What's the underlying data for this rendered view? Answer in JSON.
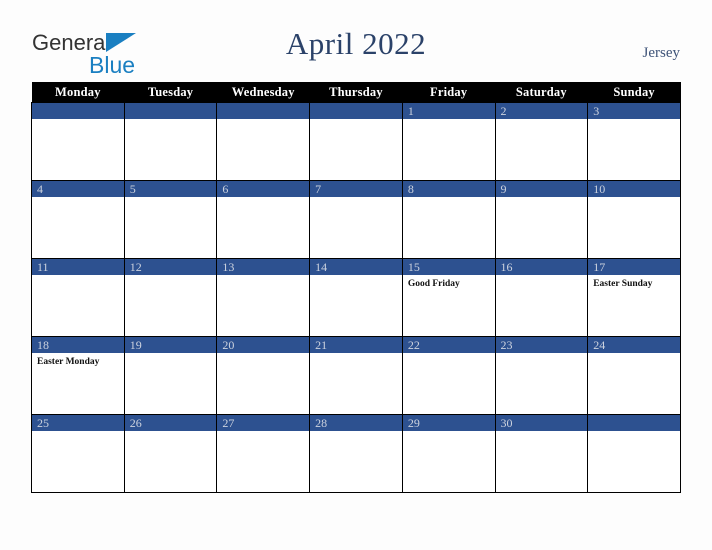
{
  "brand": {
    "name_part1": "General",
    "name_part2": "Blue",
    "triangle_icon": "blue-triangle-icon",
    "colors": {
      "dark": "#333333",
      "blue": "#1a7fc1"
    }
  },
  "header": {
    "title": "April 2022",
    "location": "Jersey",
    "title_color": "#2b4269",
    "location_color": "#3e5378"
  },
  "calendar": {
    "weekday_headers": [
      "Monday",
      "Tuesday",
      "Wednesday",
      "Thursday",
      "Friday",
      "Saturday",
      "Sunday"
    ],
    "header_bg": "#000000",
    "header_fg": "#ffffff",
    "daybar_bg": "#2d5190",
    "daybar_fg": "#ccd2de",
    "cell_bg": "#ffffff",
    "border_color": "#000000",
    "weeks": [
      [
        {
          "day": "",
          "events": []
        },
        {
          "day": "",
          "events": []
        },
        {
          "day": "",
          "events": []
        },
        {
          "day": "",
          "events": []
        },
        {
          "day": "1",
          "events": []
        },
        {
          "day": "2",
          "events": []
        },
        {
          "day": "3",
          "events": []
        }
      ],
      [
        {
          "day": "4",
          "events": []
        },
        {
          "day": "5",
          "events": []
        },
        {
          "day": "6",
          "events": []
        },
        {
          "day": "7",
          "events": []
        },
        {
          "day": "8",
          "events": []
        },
        {
          "day": "9",
          "events": []
        },
        {
          "day": "10",
          "events": []
        }
      ],
      [
        {
          "day": "11",
          "events": []
        },
        {
          "day": "12",
          "events": []
        },
        {
          "day": "13",
          "events": []
        },
        {
          "day": "14",
          "events": []
        },
        {
          "day": "15",
          "events": [
            "Good Friday"
          ]
        },
        {
          "day": "16",
          "events": []
        },
        {
          "day": "17",
          "events": [
            "Easter Sunday"
          ]
        }
      ],
      [
        {
          "day": "18",
          "events": [
            "Easter Monday"
          ]
        },
        {
          "day": "19",
          "events": []
        },
        {
          "day": "20",
          "events": []
        },
        {
          "day": "21",
          "events": []
        },
        {
          "day": "22",
          "events": []
        },
        {
          "day": "23",
          "events": []
        },
        {
          "day": "24",
          "events": []
        }
      ],
      [
        {
          "day": "25",
          "events": []
        },
        {
          "day": "26",
          "events": []
        },
        {
          "day": "27",
          "events": []
        },
        {
          "day": "28",
          "events": []
        },
        {
          "day": "29",
          "events": []
        },
        {
          "day": "30",
          "events": []
        },
        {
          "day": "",
          "events": []
        }
      ]
    ]
  }
}
